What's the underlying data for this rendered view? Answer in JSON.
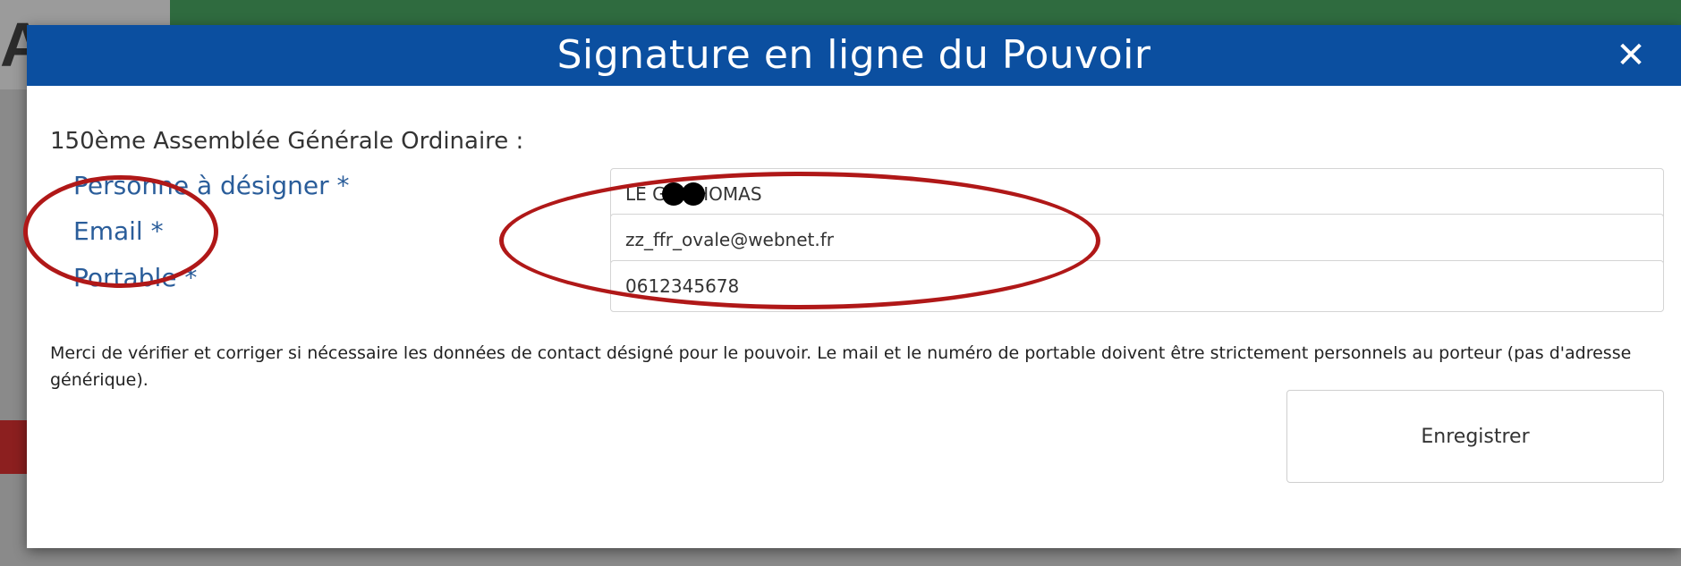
{
  "background": {
    "logo_letter": "A"
  },
  "modal": {
    "title": "Signature en ligne du Pouvoir",
    "close_icon": "close-icon",
    "close_glyph": "✕",
    "section_title": "150ème Assemblée Générale Ordinaire :",
    "fields": [
      {
        "label": "Personne à désigner *",
        "value": "LE GR THOMAS"
      },
      {
        "label": "Email *",
        "value": "zz_ffr_ovale@webnet.fr"
      },
      {
        "label": "Portable *",
        "value": "0612345678"
      }
    ],
    "notice": "Merci de vérifier et corriger si nécessaire les données de contact désigné pour le pouvoir. Le mail et le numéro de portable doivent être strictement personnels au porteur (pas d'adresse générique).",
    "save_label": "Enregistrer"
  },
  "colors": {
    "header_blue": "#0b4fa0",
    "label_blue": "#2a5d9a",
    "annotation_red": "#b01818"
  }
}
